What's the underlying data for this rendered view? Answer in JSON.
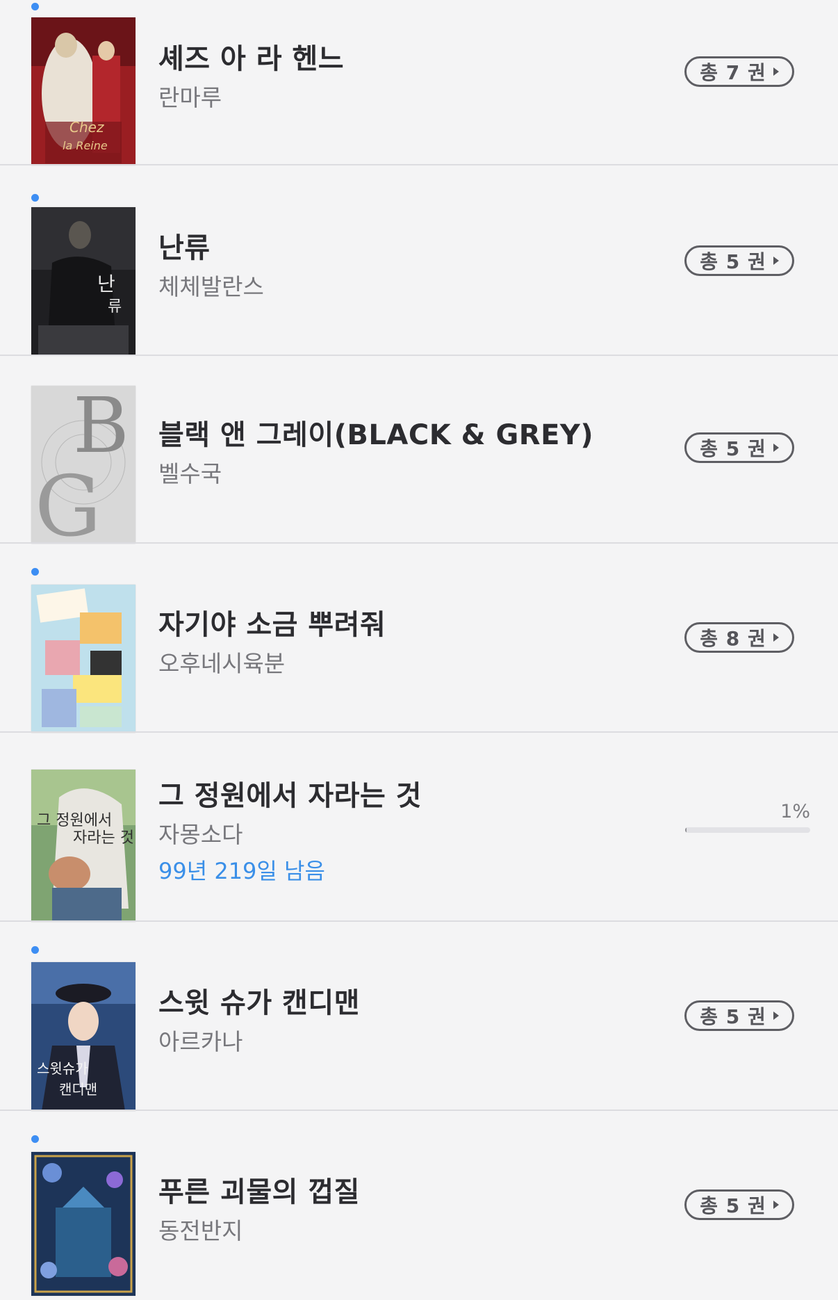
{
  "books": [
    {
      "title": "셰즈 아 라 헨느",
      "author": "란마루",
      "volumes": "총 7 권",
      "is_new": true
    },
    {
      "title": "난류",
      "author": "체체발란스",
      "volumes": "총 5 권",
      "is_new": true
    },
    {
      "title": "블랙 앤 그레이(BLACK & GREY)",
      "author": "벨수국",
      "volumes": "총 5 권",
      "is_new": false
    },
    {
      "title": "자기야 소금 뿌려줘",
      "author": "오후네시육분",
      "volumes": "총 8 권",
      "is_new": true
    },
    {
      "title": "그 정원에서 자라는 것",
      "author": "자몽소다",
      "remaining": "99년 219일 남음",
      "progress_label": "1%",
      "progress": 0.01,
      "is_new": false
    },
    {
      "title": "스윗 슈가 캔디맨",
      "author": "아르카나",
      "volumes": "총 5 권",
      "is_new": true
    },
    {
      "title": "푸른 괴물의 껍질",
      "author": "동전반지",
      "volumes": "총 5 권",
      "is_new": true
    }
  ],
  "colors": {
    "background": "#f4f4f5",
    "new_dot": "#3d8ef3",
    "remaining_text": "#3a8fe8",
    "divider": "#dcdce0"
  }
}
